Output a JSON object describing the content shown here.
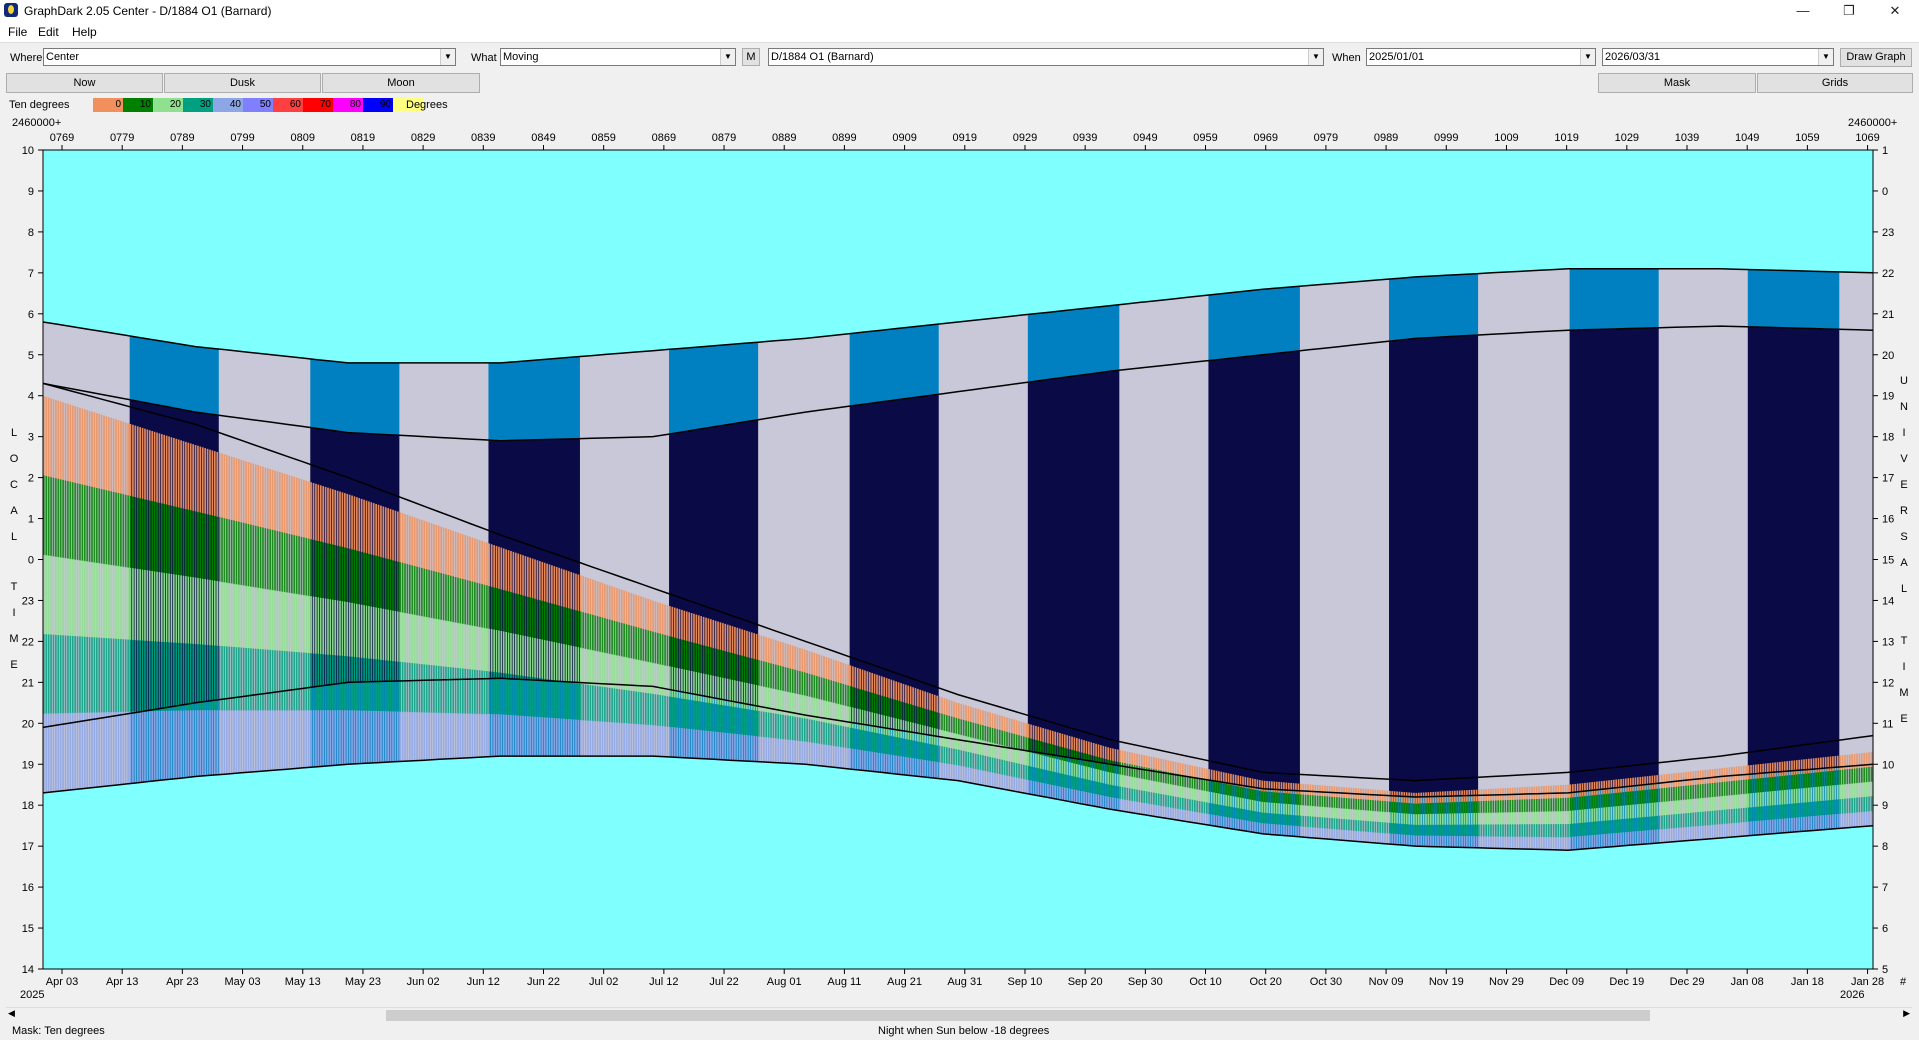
{
  "window": {
    "title": "GraphDark 2.05  Center  -  D/1884 O1 (Barnard)",
    "controls": {
      "minimize": "—",
      "maximize": "❐",
      "close": "✕"
    }
  },
  "menu": [
    "File",
    "Edit",
    "Help"
  ],
  "toolbar": {
    "where_label": "Where",
    "where_value": "Center",
    "what_label": "What",
    "what_value": "Moving",
    "m_button": "M",
    "object_value": "D/1884 O1 (Barnard)",
    "when_label": "When",
    "start_date": "2025/01/01",
    "end_date": "2026/03/31",
    "draw_button": "Draw Graph"
  },
  "buttons": {
    "now": "Now",
    "dusk": "Dusk",
    "moon": "Moon",
    "mask": "Mask",
    "grids": "Grids"
  },
  "legend": {
    "title": "Ten degrees",
    "suffix": "Degrees",
    "items": [
      {
        "label": "0",
        "color": "#f0905c"
      },
      {
        "label": "10",
        "color": "#008000"
      },
      {
        "label": "20",
        "color": "#8fe08f"
      },
      {
        "label": "30",
        "color": "#00a080"
      },
      {
        "label": "40",
        "color": "#8da6e6"
      },
      {
        "label": "50",
        "color": "#8080ff"
      },
      {
        "label": "60",
        "color": "#ff4040"
      },
      {
        "label": "70",
        "color": "#ff0000"
      },
      {
        "label": "80",
        "color": "#ff00ff"
      },
      {
        "label": "90",
        "color": "#0000ff"
      },
      {
        "label": "",
        "color": "#ffff80"
      }
    ]
  },
  "status": {
    "left": "Mask:  Ten degrees",
    "center": "Night when Sun below -18 degrees"
  },
  "chart_data": {
    "type": "area",
    "jd_prefix_left": "2460000+",
    "jd_prefix_right": "2460000+",
    "jd_ticks": [
      "0769",
      "0779",
      "0789",
      "0799",
      "0809",
      "0819",
      "0829",
      "0839",
      "0849",
      "0859",
      "0869",
      "0879",
      "0889",
      "0899",
      "0909",
      "0919",
      "0929",
      "0939",
      "0949",
      "0959",
      "0969",
      "0979",
      "0989",
      "0999",
      "1009",
      "1019",
      "1029",
      "1039",
      "1049",
      "1059",
      "1069"
    ],
    "date_ticks": [
      "Apr 03",
      "Apr 13",
      "Apr 23",
      "May 03",
      "May 13",
      "May 23",
      "Jun 02",
      "Jun 12",
      "Jun 22",
      "Jul 02",
      "Jul 12",
      "Jul 22",
      "Aug 01",
      "Aug 11",
      "Aug 21",
      "Aug 31",
      "Sep 10",
      "Sep 20",
      "Sep 30",
      "Oct 10",
      "Oct 20",
      "Oct 30",
      "Nov 09",
      "Nov 19",
      "Nov 29",
      "Dec 09",
      "Dec 19",
      "Dec 29",
      "Jan 08",
      "Jan 18",
      "Jan 28"
    ],
    "year_left": "2025",
    "year_right": "2026",
    "x_end_label": "#",
    "local_time_ticks": [
      "10",
      "9",
      "8",
      "7",
      "6",
      "5",
      "4",
      "3",
      "2",
      "1",
      "0",
      "23",
      "22",
      "21",
      "20",
      "19",
      "18",
      "17",
      "16",
      "15",
      "14"
    ],
    "universal_time_ticks": [
      "1",
      "0",
      "23",
      "22",
      "21",
      "20",
      "19",
      "18",
      "17",
      "16",
      "15",
      "14",
      "13",
      "12",
      "11",
      "10",
      "9",
      "8",
      "7",
      "6",
      "5"
    ],
    "left_axis_title": "LOCAL TIME",
    "right_axis_title": "UNIVERSAL TIME",
    "dusk_local_hours": [
      5.8,
      5.2,
      4.8,
      4.8,
      5.1,
      5.4,
      5.8,
      6.2,
      6.6,
      6.9,
      7.1,
      7.1,
      7.0
    ],
    "dark_start_local_hours": [
      4.3,
      3.6,
      3.1,
      2.9,
      3.0,
      3.6,
      4.1,
      4.6,
      5.0,
      5.4,
      5.6,
      5.7,
      5.6
    ],
    "dawn_local_hours": [
      18.3,
      18.7,
      19.0,
      19.2,
      19.2,
      19.0,
      18.6,
      17.9,
      17.3,
      17.0,
      16.9,
      17.2,
      17.5
    ],
    "dark_end_local_hours": [
      19.9,
      20.5,
      21.0,
      21.1,
      20.9,
      20.2,
      19.6,
      19.0,
      18.4,
      18.2,
      18.3,
      18.7,
      19.0
    ],
    "object_rise_local_hours": [
      4.3,
      3.3,
      2.0,
      0.6,
      23.3,
      22.0,
      20.7,
      19.6,
      18.8,
      18.6,
      18.8,
      19.2,
      19.7
    ],
    "object_set_local_hours": [
      4.0,
      2.8,
      1.6,
      0.3,
      23.0,
      21.8,
      20.5,
      19.4,
      18.6,
      18.3,
      18.5,
      18.9,
      19.3
    ],
    "series_x_dates": [
      "Apr 03",
      "May 13",
      "Jun 22",
      "Aug 01",
      "Sep 10",
      "Oct 20",
      "Nov 29",
      "Jan 08",
      "Jan 28"
    ],
    "ylim": [
      14,
      34
    ],
    "colors": {
      "day": "#80ffff",
      "twilight": "#0080c0",
      "night": "#0a0a46",
      "moonlit": "#c8c8d8"
    }
  }
}
